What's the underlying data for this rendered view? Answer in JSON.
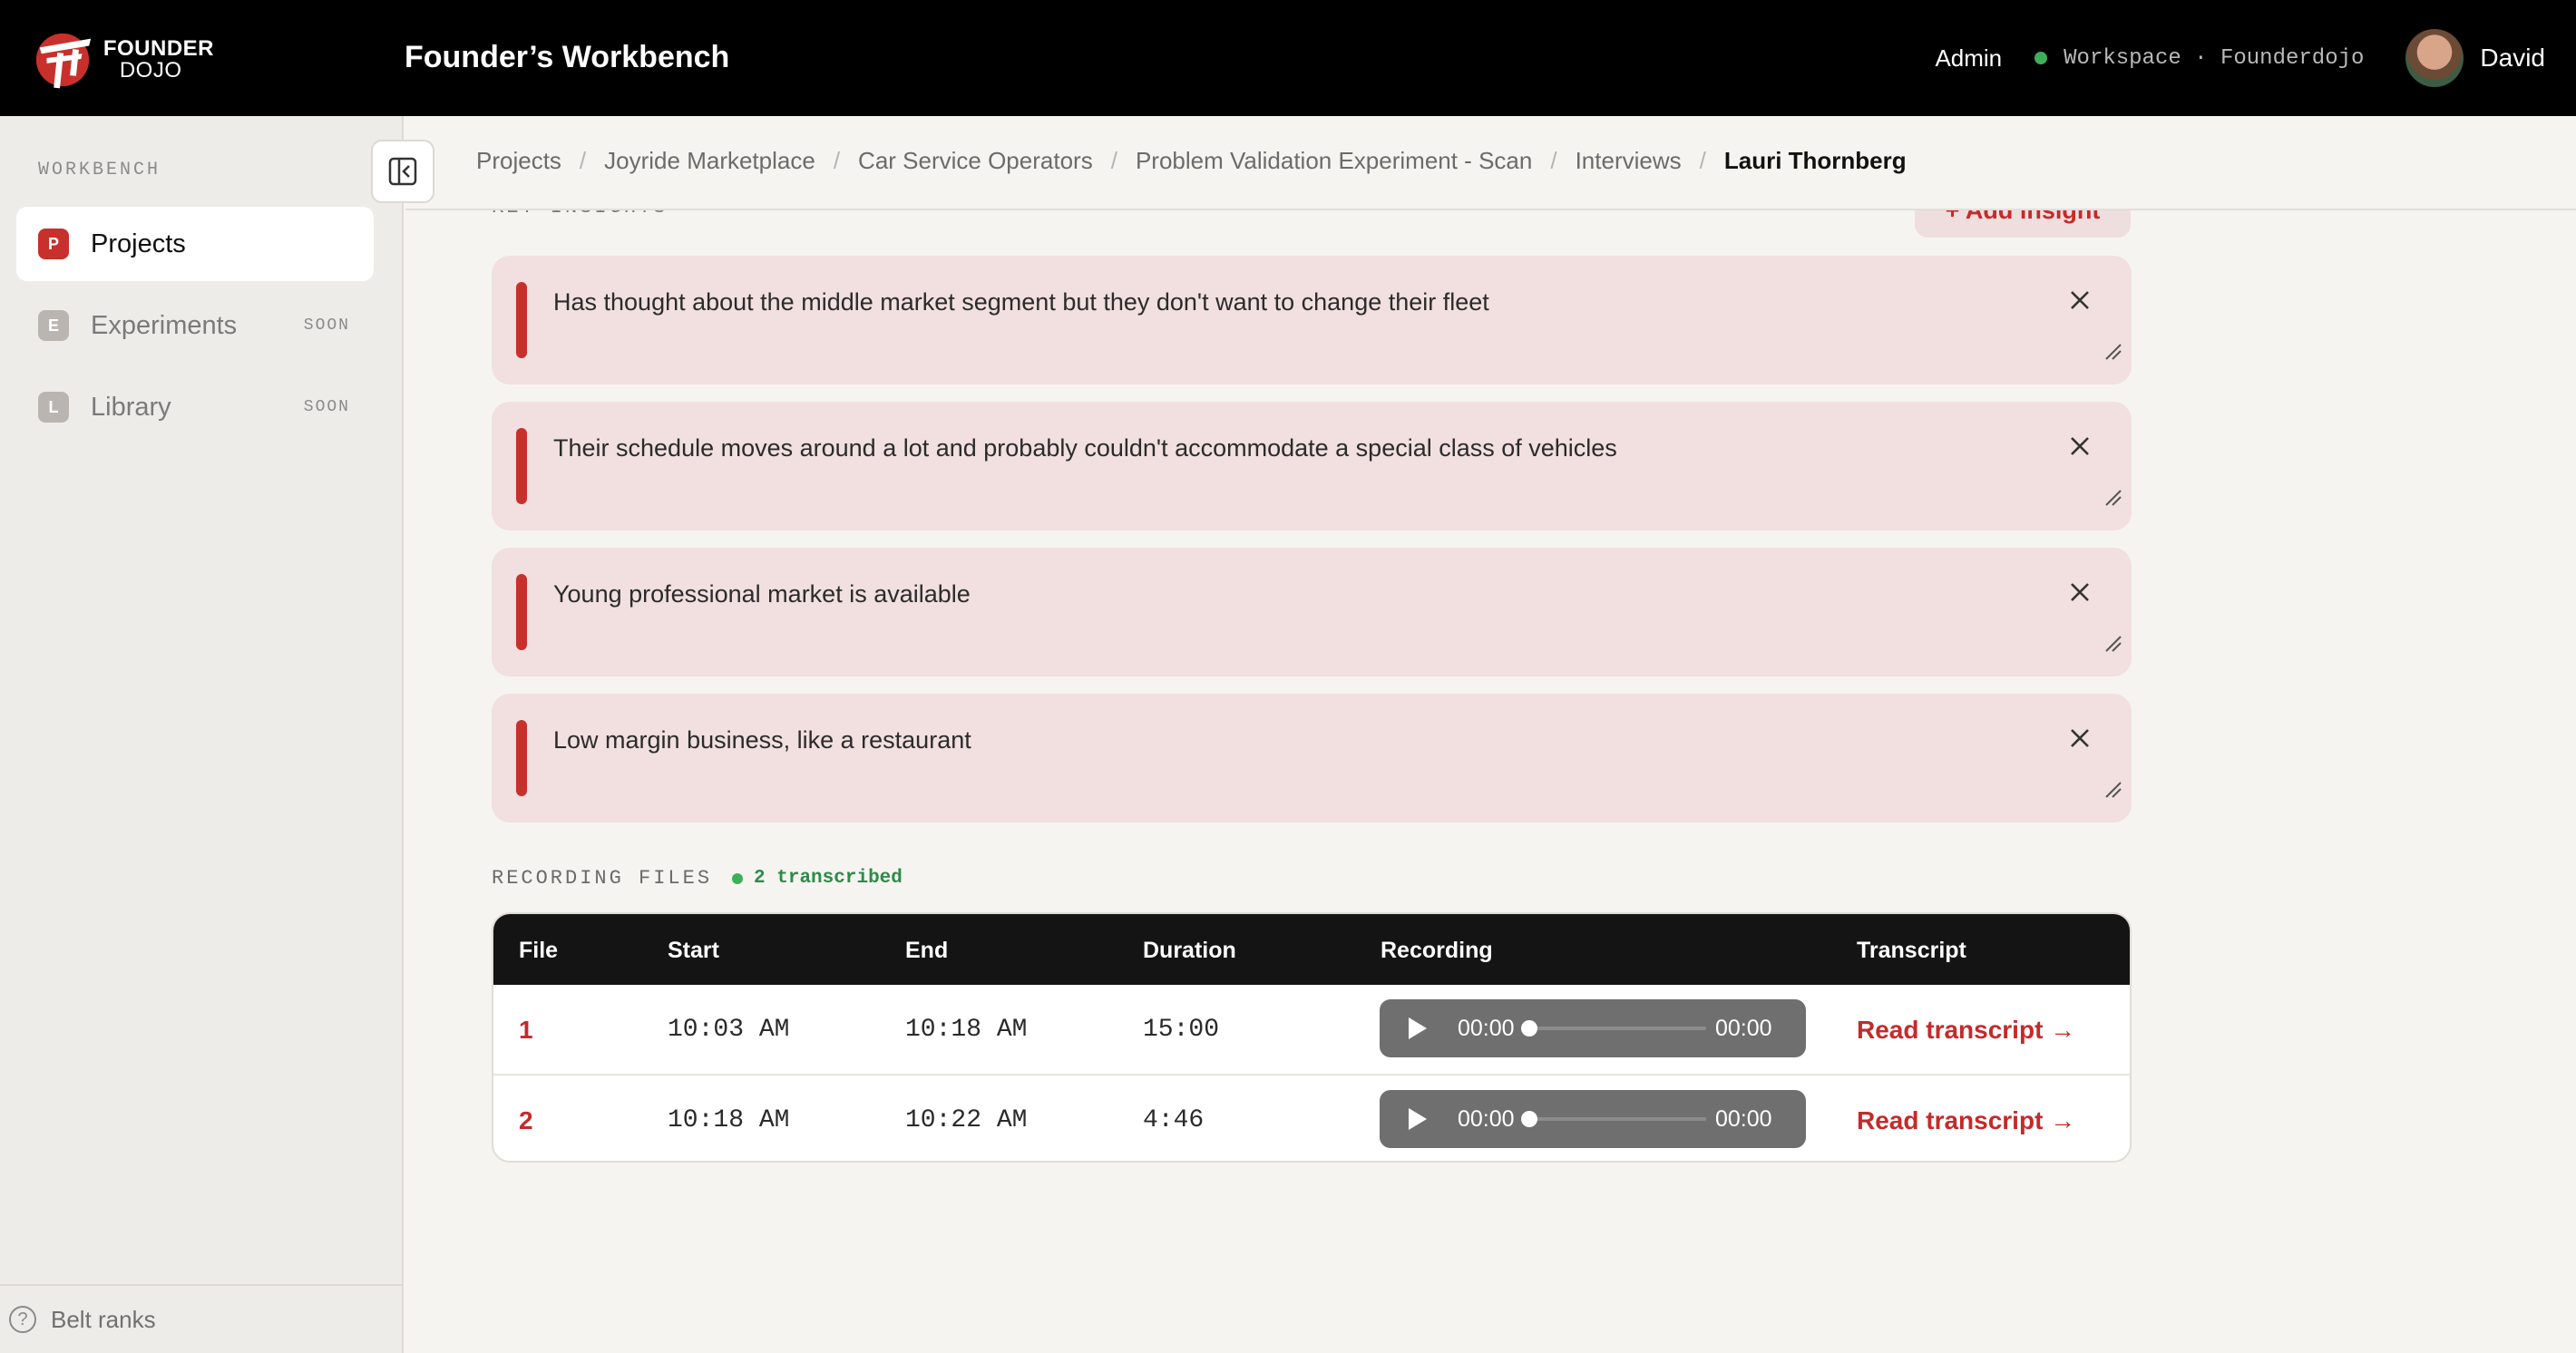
{
  "brand": {
    "line1": "FOUNDER",
    "line2": "DOJO"
  },
  "header": {
    "app_title": "Founder’s Workbench",
    "admin_label": "Admin",
    "workspace_label": "Workspace · Founderdojo",
    "user_name": "David"
  },
  "sidebar": {
    "heading": "WORKBENCH",
    "items": [
      {
        "badge": "P",
        "label": "Projects",
        "soon": "",
        "badge_color": "#c8302c"
      },
      {
        "badge": "E",
        "label": "Experiments",
        "soon": "SOON",
        "badge_color": "#b9b6b1"
      },
      {
        "badge": "L",
        "label": "Library",
        "soon": "SOON",
        "badge_color": "#b9b6b1"
      }
    ],
    "footer_label": "Belt ranks"
  },
  "breadcrumb": {
    "items": [
      "Projects",
      "Joyride Marketplace",
      "Car Service Operators",
      "Problem Validation Experiment - Scan",
      "Interviews"
    ],
    "current": "Lauri Thornberg"
  },
  "insights": {
    "heading": "KEY INSIGHTS",
    "add_label": "+ Add insight",
    "items": [
      "Has thought about the middle market segment but they don't want to change their fleet",
      "Their schedule moves around a lot and probably couldn't accommodate a special class of vehicles",
      "Young professional market is available",
      "Low margin business, like a restaurant"
    ]
  },
  "recordings": {
    "heading": "RECORDING FILES",
    "status": "2 transcribed",
    "columns": [
      "File",
      "Start",
      "End",
      "Duration",
      "Recording",
      "Transcript"
    ],
    "rows": [
      {
        "file": "1",
        "start": "10:03 AM",
        "end": "10:18 AM",
        "duration": "15:00",
        "current": "00:00",
        "total": "00:00",
        "transcript": "Read transcript →"
      },
      {
        "file": "2",
        "start": "10:18 AM",
        "end": "10:22 AM",
        "duration": "4:46",
        "current": "00:00",
        "total": "00:00",
        "transcript": "Read transcript →"
      }
    ]
  },
  "colors": {
    "accent": "#c52a2a",
    "success": "#3fae5a",
    "insight_bg": "#f1e0df"
  }
}
